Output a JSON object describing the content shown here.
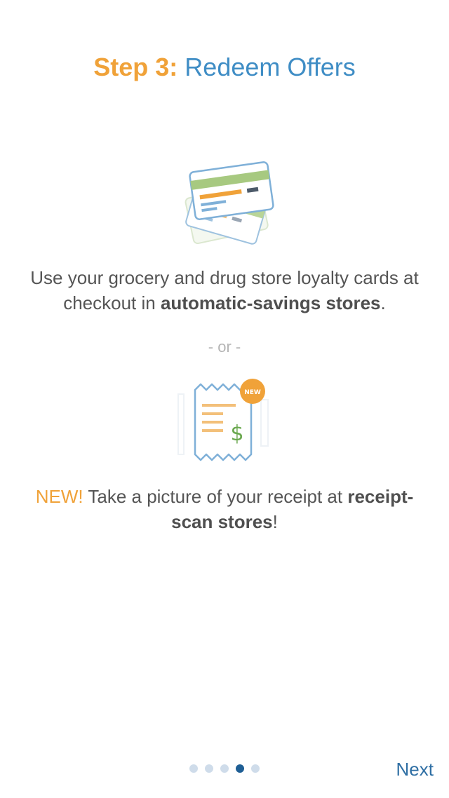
{
  "header": {
    "step_label": "Step 3:",
    "title": "Redeem Offers"
  },
  "section_loyalty": {
    "text_before": "Use your grocery and drug store loyalty cards at checkout in ",
    "text_bold": "automatic-savings stores",
    "text_after": "."
  },
  "divider": {
    "label": "- or -"
  },
  "section_receipt": {
    "new_label": "NEW!",
    "text_before": " Take a picture of your receipt at ",
    "text_bold": "receipt-scan stores",
    "text_after": "!",
    "badge_label": "NEW"
  },
  "pager": {
    "total_pages": 5,
    "current_page": 4
  },
  "footer": {
    "next_label": "Next"
  },
  "colors": {
    "accent_orange": "#f0a239",
    "accent_blue": "#3f8dc5",
    "link_blue": "#2f6fa4",
    "card_green": "#a7c980",
    "dollar_green": "#6aa84f"
  },
  "icons": {
    "cards": "loyalty-cards-icon",
    "receipt": "receipt-icon"
  }
}
